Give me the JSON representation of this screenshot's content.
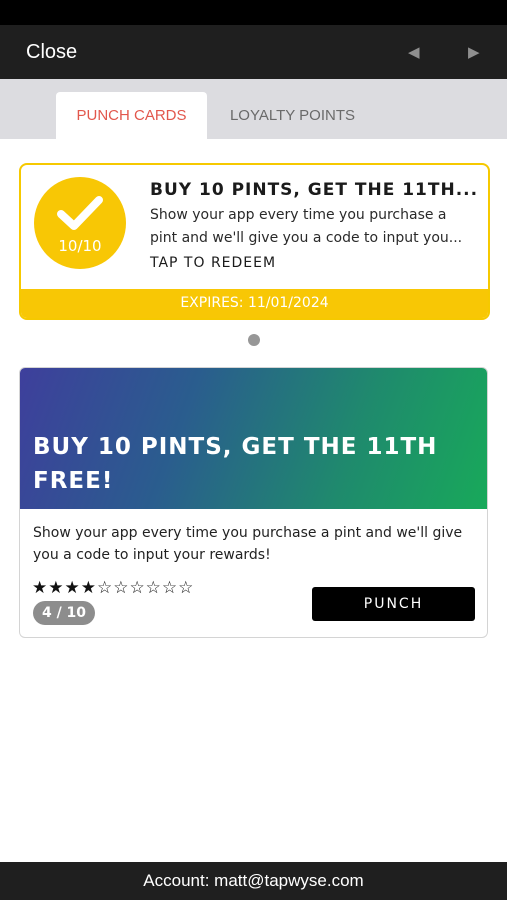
{
  "nav": {
    "close_label": "Close",
    "prev_icon": "◀",
    "next_icon": "▶"
  },
  "tabs": [
    {
      "label": "PUNCH CARDS",
      "active": true
    },
    {
      "label": "LOYALTY POINTS",
      "active": false
    }
  ],
  "reward_card": {
    "badge_count": "10/10",
    "title": "BUY 10 PINTS, GET THE 11TH...",
    "description_line1": "Show your app every time you purchase a",
    "description_line2": "pint and we'll give you a code to input you...",
    "redeem_label": "TAP TO REDEEM",
    "expiry": "EXPIRES: 11/01/2024"
  },
  "punch_card": {
    "title": "BUY 10 PINTS, GET THE 11TH FREE!",
    "description": "Show your app every time you purchase a pint and we'll give you a code to input your rewards!",
    "stars": "★★★★☆☆☆☆☆☆",
    "punched": 4,
    "total": 10,
    "count_label": "4 / 10",
    "button_label": "PUNCH"
  },
  "footer": {
    "account_text": "Account: matt@tapwyse.com"
  },
  "colors": {
    "accent_tab": "#e2574c",
    "reward_yellow": "#f8c705",
    "gradient_start": "#3e3f9c",
    "gradient_end": "#18a95a"
  }
}
